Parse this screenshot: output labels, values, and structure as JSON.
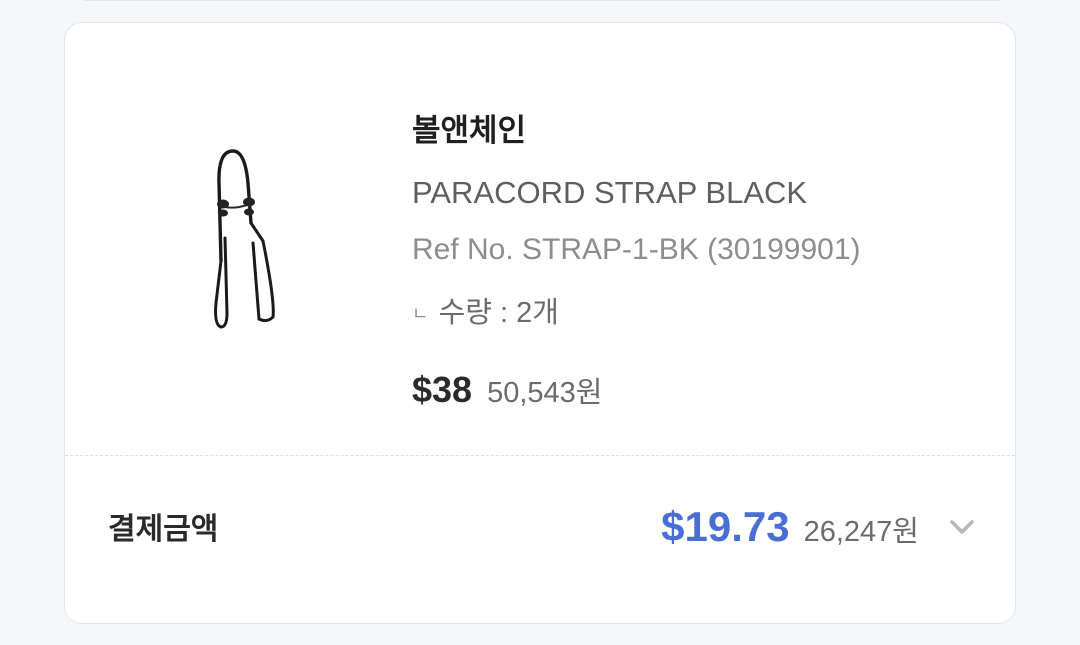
{
  "product": {
    "brand": "볼앤체인",
    "name": "PARACORD STRAP BLACK",
    "ref_no": "Ref No. STRAP-1-BK (30199901)",
    "quantity_marker": "ㄴ",
    "quantity": "수량 : 2개",
    "price_usd": "$38",
    "price_krw": "50,543원",
    "image_icon": "paracord-strap-image"
  },
  "payment": {
    "label": "결제금액",
    "total_usd": "$19.73",
    "total_krw": "26,247원",
    "expand_icon": "chevron-down-icon"
  },
  "colors": {
    "accent": "#4a6fd4",
    "text_primary": "#1f1f1f",
    "text_secondary": "#6b6b6b",
    "text_muted": "#8d8d8d",
    "background": "#f6f7f9",
    "card": "#ffffff"
  }
}
